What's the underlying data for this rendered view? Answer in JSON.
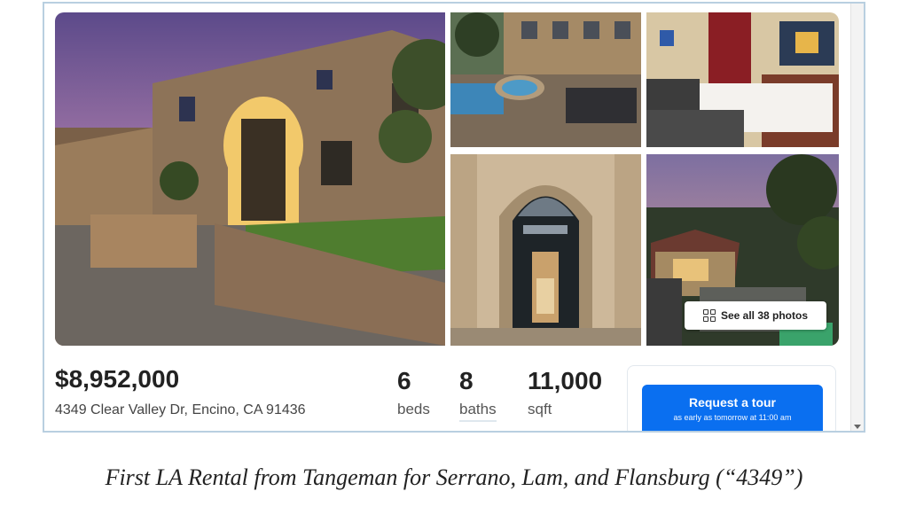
{
  "listing": {
    "price": "$8,952,000",
    "address": "4349 Clear Valley Dr, Encino, CA 91436",
    "stats": {
      "beds": {
        "value": "6",
        "label": "beds"
      },
      "baths": {
        "value": "8",
        "label": "baths"
      },
      "sqft": {
        "value": "11,000",
        "label": "sqft"
      }
    },
    "see_all_label": "See all 38 photos",
    "see_all_icon": "grid-icon",
    "tour_button": {
      "label": "Request a tour",
      "sublabel": "as early as tomorrow at 11:00 am"
    }
  },
  "caption": "First LA Rental from Tangeman for Serrano, Lam, and Flansburg (“4349”)",
  "colors": {
    "accent": "#0a6ff0",
    "card_border": "#b9cfe0"
  }
}
